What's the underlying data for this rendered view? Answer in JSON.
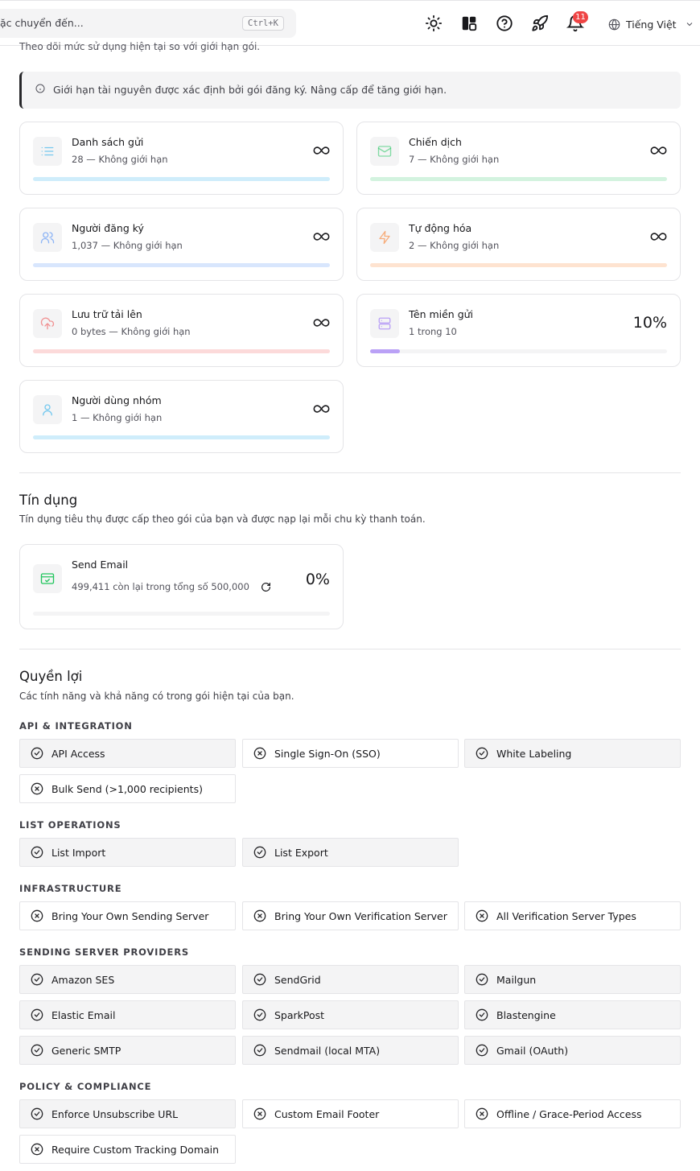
{
  "topbar": {
    "search_placeholder": "ặc chuyển đến...",
    "shortcut": "Ctrl+K",
    "notification_count": "11",
    "language": "Tiếng Việt"
  },
  "limits": {
    "subtitle": "Theo dõi mức sử dụng hiện tại so với giới hạn gói.",
    "notice": "Giới hạn tài nguyên được xác định bởi gói đăng ký. Nâng cấp để tăng giới hạn.",
    "cards": [
      {
        "title": "Danh sách gửi",
        "sub": "28 — Không giới hạn",
        "icon": "list-icon",
        "color": "#0ea5e9"
      },
      {
        "title": "Chiến dịch",
        "sub": "7 — Không giới hạn",
        "icon": "mail-icon",
        "color": "#22c55e"
      },
      {
        "title": "Người đăng ký",
        "sub": "1,037 — Không giới hạn",
        "icon": "users-icon",
        "color": "#3b82f6"
      },
      {
        "title": "Tự động hóa",
        "sub": "2 — Không giới hạn",
        "icon": "zap-icon",
        "color": "#f97316"
      },
      {
        "title": "Lưu trữ tải lên",
        "sub": "0 bytes — Không giới hạn",
        "icon": "cloud-upload-icon",
        "color": "#ef4444"
      },
      {
        "title": "Tên miền gửi",
        "sub": "1 trong 10",
        "icon": "server-icon",
        "color": "#8b5cf6",
        "percent": "10%",
        "progress": 0.1
      },
      {
        "title": "Người dùng nhóm",
        "sub": "1 — Không giới hạn",
        "icon": "user-icon",
        "color": "#0ea5e9"
      }
    ]
  },
  "credits": {
    "title": "Tín dụng",
    "subtitle": "Tín dụng tiêu thụ được cấp theo gói của bạn và được nạp lại mỗi chu kỳ thanh toán.",
    "card": {
      "title": "Send Email",
      "sub": "499,411 còn lại trong tổng số 500,000",
      "percent": "0%",
      "progress": 0.0,
      "color": "#22c55e"
    }
  },
  "entitlements": {
    "title": "Quyền lợi",
    "subtitle": "Các tính năng và khả năng có trong gói hiện tại của bạn.",
    "groups": [
      {
        "name": "API & INTEGRATION",
        "items": [
          {
            "label": "API Access",
            "on": true
          },
          {
            "label": "Single Sign-On (SSO)",
            "on": false
          },
          {
            "label": "White Labeling",
            "on": true
          },
          {
            "label": "Bulk Send (>1,000 recipients)",
            "on": false
          }
        ]
      },
      {
        "name": "LIST OPERATIONS",
        "items": [
          {
            "label": "List Import",
            "on": true
          },
          {
            "label": "List Export",
            "on": true
          }
        ]
      },
      {
        "name": "INFRASTRUCTURE",
        "items": [
          {
            "label": "Bring Your Own Sending Server",
            "on": false
          },
          {
            "label": "Bring Your Own Verification Server",
            "on": false
          },
          {
            "label": "All Verification Server Types",
            "on": false
          }
        ]
      },
      {
        "name": "SENDING SERVER PROVIDERS",
        "items": [
          {
            "label": "Amazon SES",
            "on": true
          },
          {
            "label": "SendGrid",
            "on": true
          },
          {
            "label": "Mailgun",
            "on": true
          },
          {
            "label": "Elastic Email",
            "on": true
          },
          {
            "label": "SparkPost",
            "on": true
          },
          {
            "label": "Blastengine",
            "on": true
          },
          {
            "label": "Generic SMTP",
            "on": true
          },
          {
            "label": "Sendmail (local MTA)",
            "on": true
          },
          {
            "label": "Gmail (OAuth)",
            "on": true
          }
        ]
      },
      {
        "name": "POLICY & COMPLIANCE",
        "items": [
          {
            "label": "Enforce Unsubscribe URL",
            "on": true
          },
          {
            "label": "Custom Email Footer",
            "on": false
          },
          {
            "label": "Offline / Grace-Period Access",
            "on": false
          },
          {
            "label": "Require Custom Tracking Domain",
            "on": false
          }
        ]
      }
    ]
  }
}
